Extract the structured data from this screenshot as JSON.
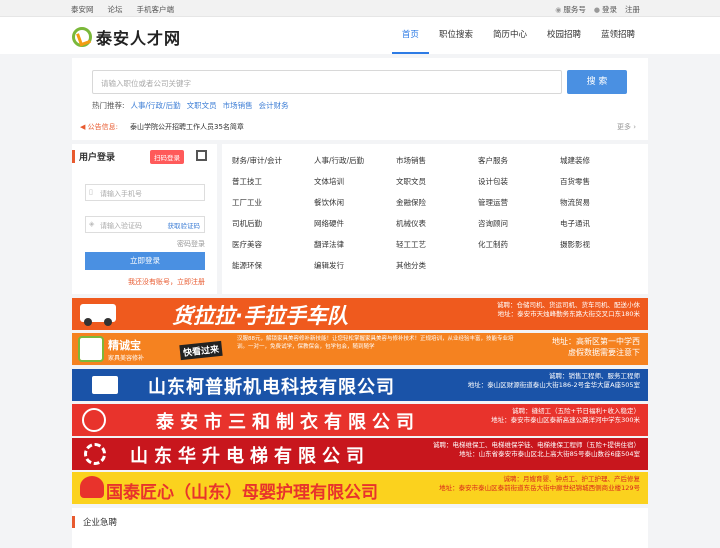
{
  "topbar": {
    "links": [
      "泰安网",
      "论坛",
      "手机客户端"
    ],
    "service": "服务号",
    "login": "登录",
    "register": "注册"
  },
  "header": {
    "logo_text": "泰安人才网",
    "nav": [
      "首页",
      "职位搜索",
      "简历中心",
      "校园招聘",
      "蓝领招聘"
    ],
    "active_nav": "首页"
  },
  "search": {
    "placeholder": "请输入职位或者公司关键字",
    "button": "搜 索",
    "hot_label": "热门推荐:",
    "hot": [
      "人事/行政/后勤",
      "文职文员",
      "市场销售",
      "会计财务"
    ],
    "notice_label": "公告信息:",
    "notice_text": "泰山学院公开招聘工作人员35名简章",
    "more": "更多"
  },
  "login_panel": {
    "title": "用户登录",
    "badge": "扫码登录",
    "phone_placeholder": "请输入手机号",
    "code_placeholder": "请输入验证码",
    "get_code": "获取验证码",
    "forgot": "密码登录",
    "submit": "立即登录",
    "register_prompt": "我还没有账号，立即注册"
  },
  "categories": [
    "财务/审计/会计",
    "人事/行政/后勤",
    "市场销售",
    "客户服务",
    "城建装修",
    "普工技工",
    "文体培训",
    "文职文员",
    "设计包装",
    "百货零售",
    "工厂工业",
    "餐饮休闲",
    "金融保险",
    "管理运营",
    "物流贸易",
    "司机后勤",
    "网络硬件",
    "机械仪表",
    "咨询顾问",
    "电子通讯",
    "医疗美容",
    "翻译法律",
    "轻工工艺",
    "化工制药",
    "摄影影视",
    "能源环保",
    "编辑发行",
    "其他分类"
  ],
  "banners": [
    {
      "title": "货拉拉·手拉手车队",
      "line1": "诚聘：仓储司机、货运司机、货车司机、配送小休",
      "line2": "地址：泰安市天烛峰勤务东路大街交叉口东180米"
    },
    {
      "brand": "精诚宝",
      "brand_sub": "家具美容修补",
      "tag": "快看过来",
      "mid": "汉服88元，解锁家具美容修补新技能！让您轻松掌握家具美容与修补技术！正规培训，从业经验丰富，技能专业培训。一对一，免费试学，保教保会，包学包会，随到随学",
      "line1": "地址：高新区第一中学西",
      "line2": "虚假数据需要注意下"
    },
    {
      "title": "山东柯普斯机电科技有限公司",
      "line1": "诚聘：销售工程师、服务工程师",
      "line2": "地址：泰山区财源街道泰山大街186-2号金华大厦A座505室"
    },
    {
      "title": "泰安市三和制衣有限公司",
      "line1": "诚聘：缝纫工（五险+节日福利+收入稳定）",
      "line2": "地址：泰安市泰山区泰新高速公路洋河中学东300米"
    },
    {
      "title": "山东华升电梯有限公司",
      "line1": "诚聘：电梯维保工、电梯维保学徒、电梯维保工程师（五险+提供住宿）",
      "line2": "地址：山东省泰安市泰山区北上高大街85号泰山数谷6座504室"
    },
    {
      "title": "国泰匠心（山东）母婴护理有限公司",
      "line1": "诚聘：月嫂育婴、钟点工、护工护理、产后修复",
      "line2": "地址：泰安市泰山区泰前街道东岳大街中廊世纪锦城西侧商业楼129号"
    }
  ],
  "jobs": {
    "title": "企业急聘"
  }
}
